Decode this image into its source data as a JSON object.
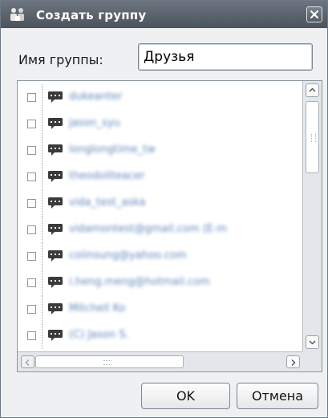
{
  "window": {
    "title": "Создать группу",
    "icon": "users-group-icon",
    "close_icon": "close-icon"
  },
  "form": {
    "group_name_label": "Имя группы:",
    "group_name_value": "Друзья"
  },
  "contacts": [
    {
      "name": "dukeanter",
      "checked": false,
      "icon": "chat-icon"
    },
    {
      "name": "jason_syu",
      "checked": false,
      "icon": "chat-icon"
    },
    {
      "name": "longlongtime_tw",
      "checked": false,
      "icon": "chat-icon"
    },
    {
      "name": "theodoliteacer",
      "checked": false,
      "icon": "chat-icon"
    },
    {
      "name": "vida_test_aska",
      "checked": false,
      "icon": "chat-icon"
    },
    {
      "name": "vidamontest@gmail.com (E-m",
      "checked": false,
      "icon": "chat-icon"
    },
    {
      "name": "colinsung@yahoo.com",
      "checked": false,
      "icon": "chat-icon"
    },
    {
      "name": "i.heng.meng@hotmail.com",
      "checked": false,
      "icon": "chat-icon"
    },
    {
      "name": "Mitchell Ko",
      "checked": false,
      "icon": "chat-icon"
    },
    {
      "name": "(C) Jason S.",
      "checked": false,
      "icon": "chat-icon"
    }
  ],
  "buttons": {
    "ok_label": "OK",
    "cancel_label": "Отмена"
  },
  "colors": {
    "titlebar": "#5b636c",
    "contact_text": "#4e79b4",
    "chat_icon": "#3a3a3a"
  }
}
